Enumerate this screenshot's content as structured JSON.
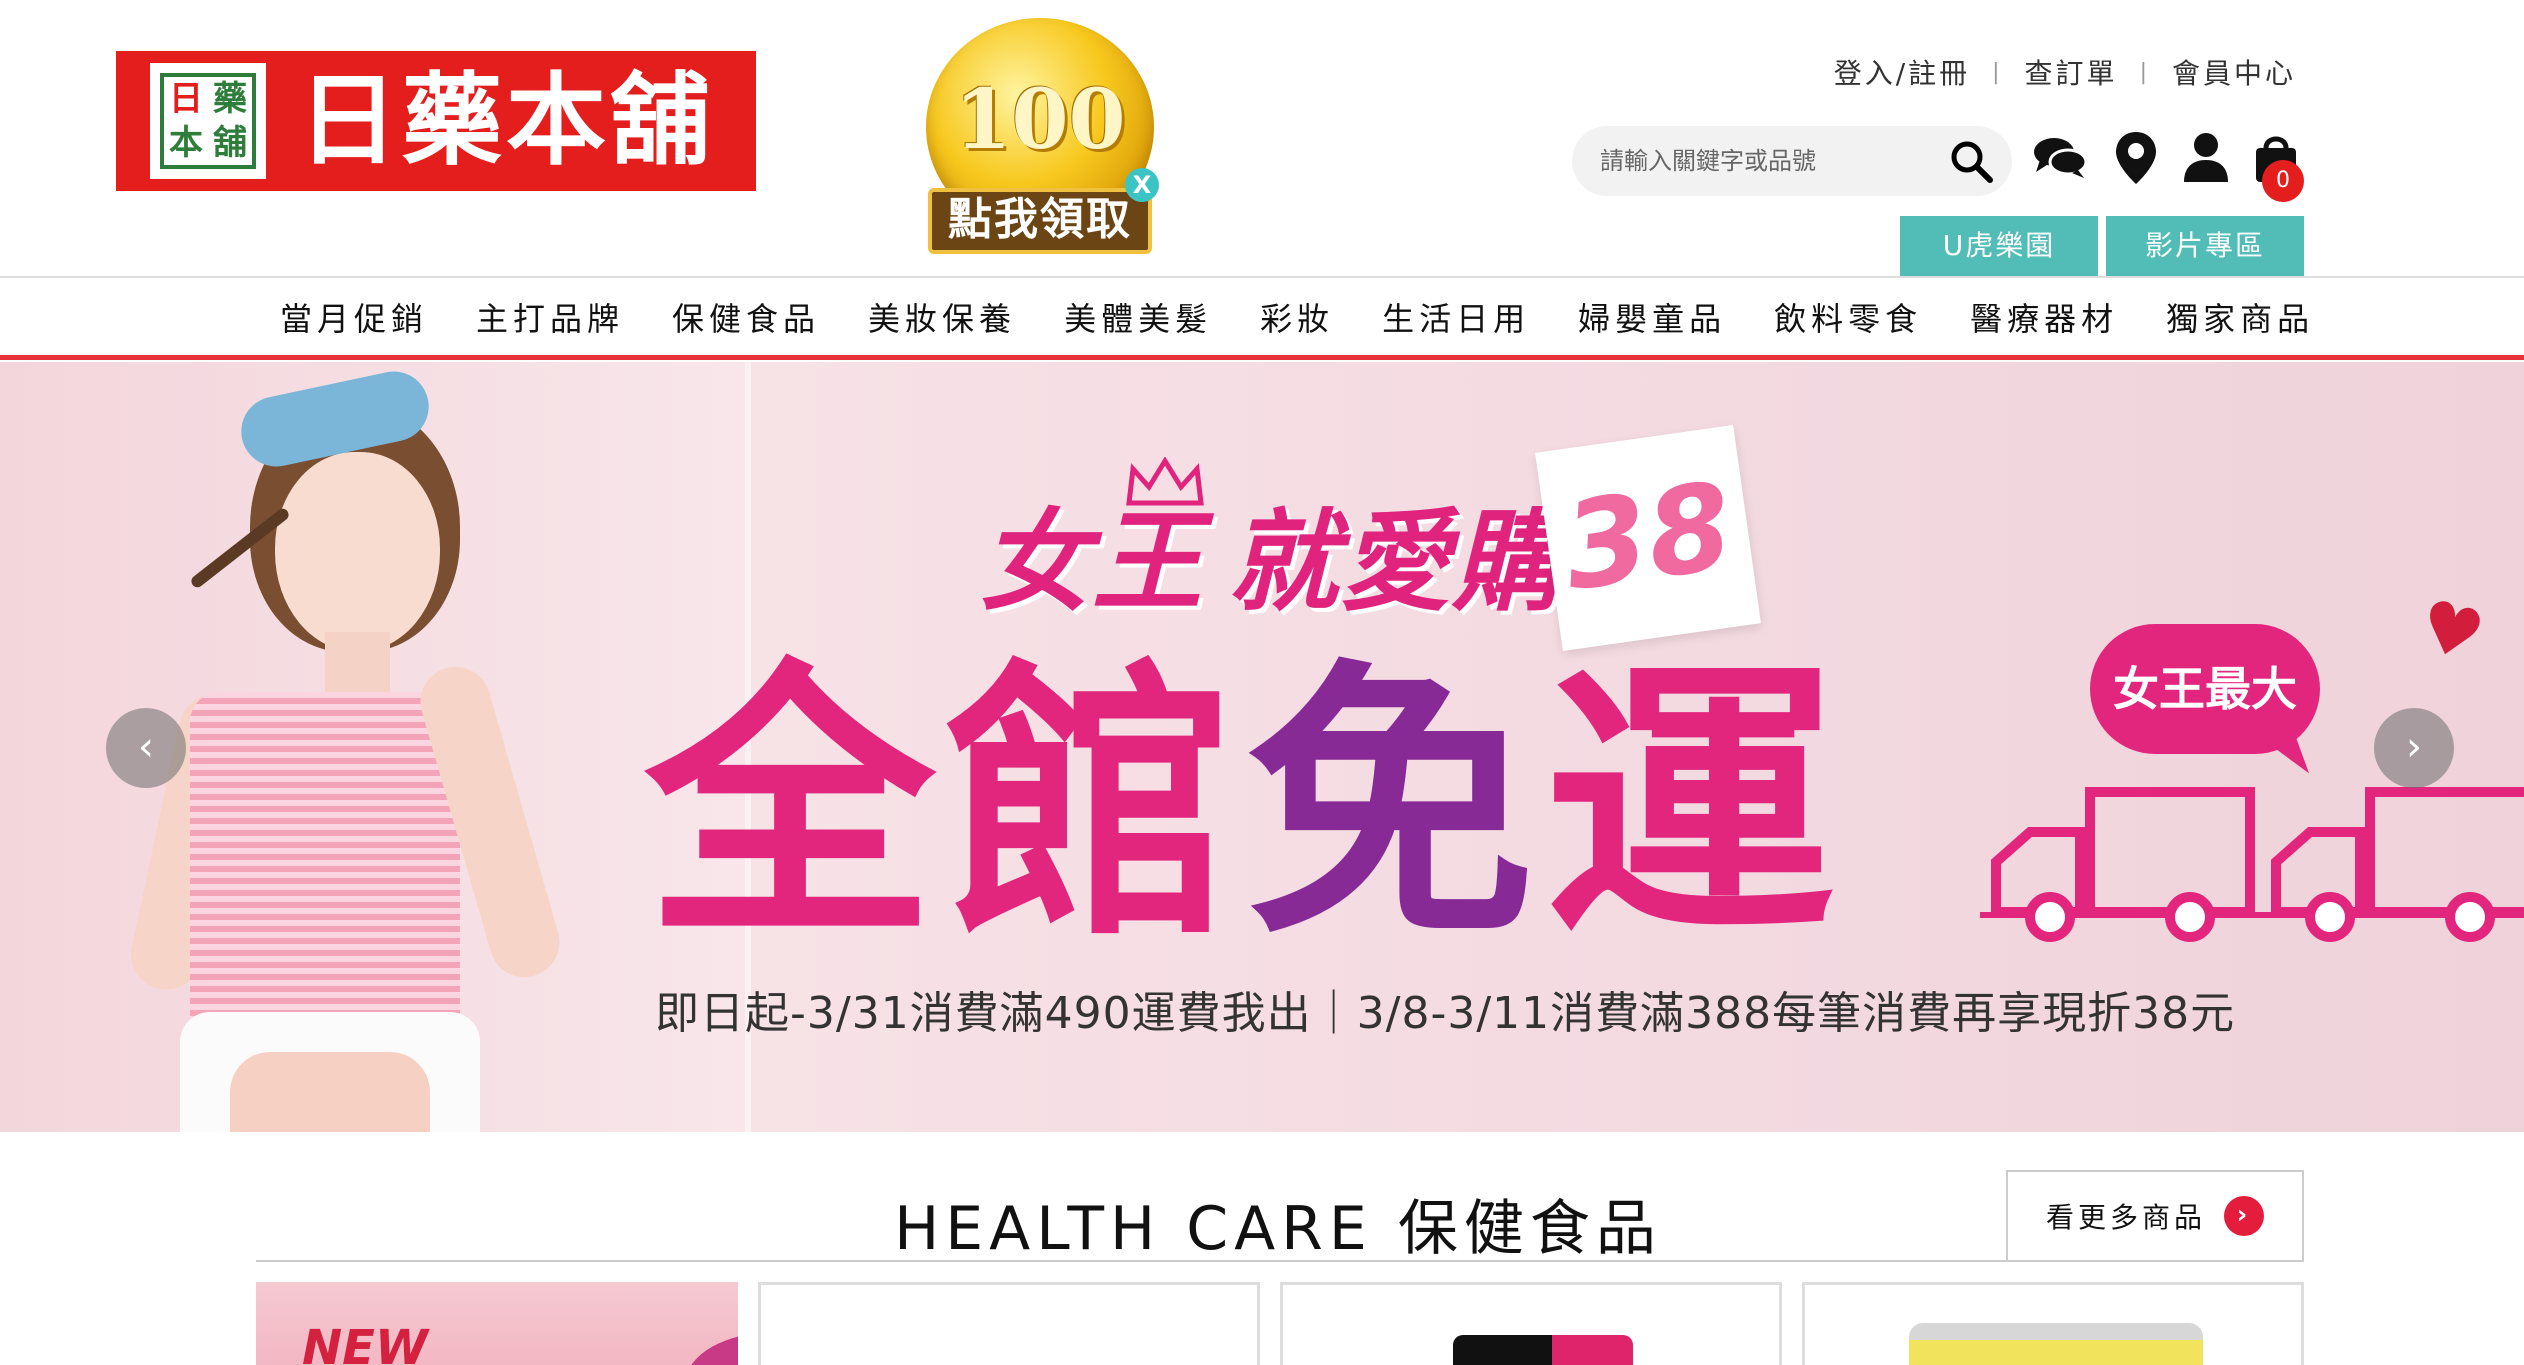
{
  "header": {
    "logo_text": "日藥本舖",
    "logo_mark": [
      "日",
      "藥",
      "本",
      "舖"
    ],
    "coin": {
      "amount": "100",
      "label": "點我領取$",
      "close": "X"
    },
    "top_links": [
      "登入/註冊",
      "查訂單",
      "會員中心"
    ],
    "search": {
      "placeholder": "請輸入關鍵字或品號"
    },
    "icons": [
      "search-icon",
      "chat-icon",
      "location-icon",
      "user-icon",
      "cart-icon"
    ],
    "cart_count": "0",
    "buttons": [
      "U虎樂園",
      "影片專區"
    ]
  },
  "nav": [
    "當月促銷",
    "主打品牌",
    "保健食品",
    "美妝保養",
    "美體美髮",
    "彩妝",
    "生活日用",
    "婦嬰童品",
    "飲料零食",
    "醫療器材",
    "獨家商品"
  ],
  "banner": {
    "title_a": "女王",
    "title_b": "就愛購",
    "tag": "38",
    "main": [
      "全館",
      "免",
      "運"
    ],
    "bubble": "女王最大",
    "subtitle": "即日起-3/31消費滿490運費我出｜3/8-3/11消費滿388每筆消費再享現折38元",
    "prev": "‹",
    "next": "›"
  },
  "section": {
    "title": "HEALTH CARE 保健食品",
    "more": "看更多商品",
    "more_arrow": "›",
    "new_badge": "NEW"
  },
  "colors": {
    "brand_red": "#e41d1d",
    "teal": "#52bdb7",
    "banner_pink": "#e2267d",
    "banner_purple": "#882a96",
    "nav_underline": "#e6313b"
  }
}
